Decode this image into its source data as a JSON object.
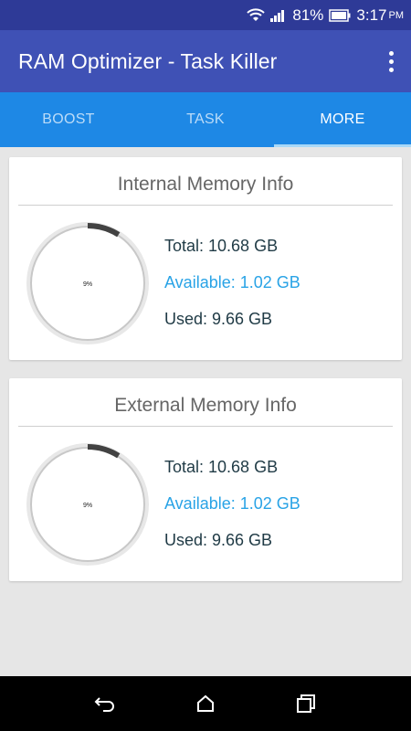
{
  "status_bar": {
    "battery": "81%",
    "time": "3:17",
    "time_suffix": "PM"
  },
  "app_bar": {
    "title": "RAM Optimizer - Task Killer"
  },
  "tabs": [
    {
      "label": "BOOST",
      "active": false
    },
    {
      "label": "TASK",
      "active": false
    },
    {
      "label": "MORE",
      "active": true
    }
  ],
  "internal": {
    "title": "Internal Memory Info",
    "percent_label": "9%",
    "used_fraction": 0.09,
    "total": "Total: 10.68 GB",
    "available": "Available: 1.02 GB",
    "used": "Used: 9.66 GB"
  },
  "external": {
    "title": "External Memory Info",
    "percent_label": "9%",
    "used_fraction": 0.09,
    "total": "Total: 10.68 GB",
    "available": "Available: 1.02 GB",
    "used": "Used: 9.66 GB"
  },
  "colors": {
    "status_bar": "#2e3a97",
    "app_bar": "#3f51b5",
    "tab_bar": "#1e88e5",
    "available_text": "#29a3e6",
    "gauge_track": "#e8e8e8",
    "gauge_fill": "#424242"
  }
}
